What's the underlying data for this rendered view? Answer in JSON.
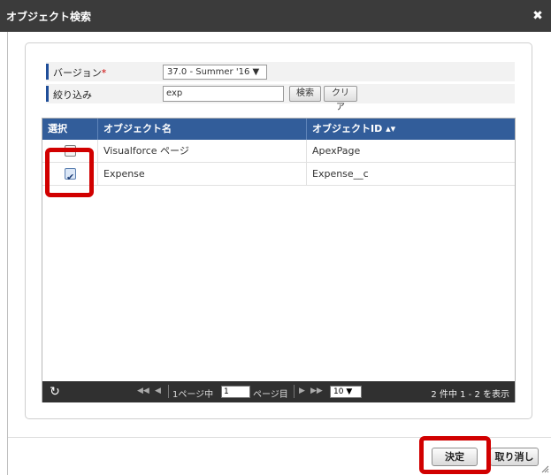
{
  "dialog": {
    "title": "オブジェクト検索",
    "close_icon": "close-icon"
  },
  "form": {
    "version_label": "バージョン",
    "version_required_mark": "*",
    "version_value": "37.0 - Summer '16 ▼",
    "filter_label": "絞り込み",
    "filter_value": "exp",
    "search_button": "検索",
    "clear_button": "クリア"
  },
  "grid": {
    "columns": [
      "選択",
      "オブジェクト名",
      "オブジェクトID"
    ],
    "sort_icon": "sort-icon",
    "rows": [
      {
        "selected": false,
        "name": "Visualforce ページ",
        "id": "ApexPage"
      },
      {
        "selected": true,
        "name": "Expense",
        "id": "Expense__c"
      }
    ]
  },
  "pager": {
    "refresh_icon": "refresh-icon",
    "first_icon": "◀◀",
    "prev_icon": "◀",
    "page_prefix": "1ページ中",
    "page_value": "1",
    "page_suffix": "ページ目",
    "next_icon": "▶",
    "last_icon": "▶▶",
    "rows_per_page": "10 ▼",
    "count_text": "2 件中 1 - 2 を表示"
  },
  "footer": {
    "ok_button": "決定",
    "cancel_button": "取り消し"
  },
  "colors": {
    "titlebar": "#3b3b3b",
    "grid_header": "#325d9a",
    "highlight": "#d10000",
    "pager_bg": "#303030"
  }
}
